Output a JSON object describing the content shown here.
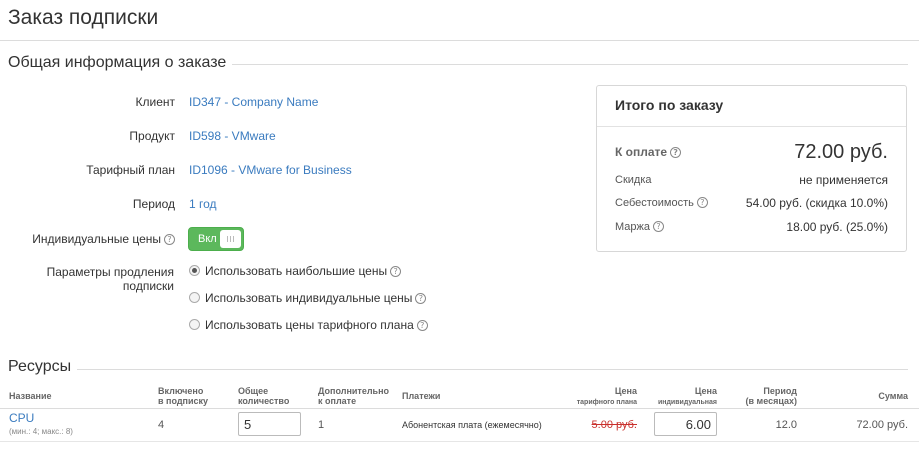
{
  "page_title": "Заказ подписки",
  "order_info": {
    "title": "Общая информация о заказе",
    "client_label": "Клиент",
    "client_value": "ID347 - Company Name",
    "product_label": "Продукт",
    "product_value": "ID598 - VMware",
    "plan_label": "Тарифный план",
    "plan_value": "ID1096 - VMware for Business",
    "period_label": "Период",
    "period_value": "1 год",
    "individual_prices_label": "Индивидуальные цены",
    "toggle_text": "Вкл",
    "renewal_label": "Параметры продления подписки",
    "renewal_options": [
      {
        "label": "Использовать наибольшие цены",
        "checked": true
      },
      {
        "label": "Использовать индивидуальные цены",
        "checked": false
      },
      {
        "label": "Использовать цены тарифного плана",
        "checked": false
      }
    ]
  },
  "summary": {
    "title": "Итого по заказу",
    "to_pay_label": "К оплате",
    "to_pay_value": "72.00 руб.",
    "discount_label": "Скидка",
    "discount_value": "не применяется",
    "cost_label": "Себестоимость",
    "cost_value": "54.00 руб. (скидка 10.0%)",
    "margin_label": "Маржа",
    "margin_value": "18.00 руб. (25.0%)"
  },
  "resources": {
    "title": "Ресурсы",
    "headers": {
      "name": "Название",
      "included_1": "Включено",
      "included_2": "в подписку",
      "total_1": "Общее",
      "total_2": "количество",
      "extra_1": "Дополнительно",
      "extra_2": "к оплате",
      "payments": "Платежи",
      "plan_price_1": "Цена",
      "plan_price_2": "тарифного плана",
      "ind_price_1": "Цена",
      "ind_price_2": "индивидуальная",
      "period_1": "Период",
      "period_2": "(в месяцах)",
      "sum": "Сумма"
    },
    "rows": [
      {
        "name": "CPU",
        "limits": "(мин.: 4; макс.: 8)",
        "included": "4",
        "total": "5",
        "extra": "1",
        "payment": "Абонентская плата (ежемесячно)",
        "plan_price": "5.00 руб.",
        "ind_price": "6.00",
        "period": "12.0",
        "sum": "72.00 руб."
      }
    ]
  },
  "colors": {
    "link": "#3a7bbf",
    "toggle_on": "#5cb85c",
    "strike_price": "#c9302c"
  }
}
